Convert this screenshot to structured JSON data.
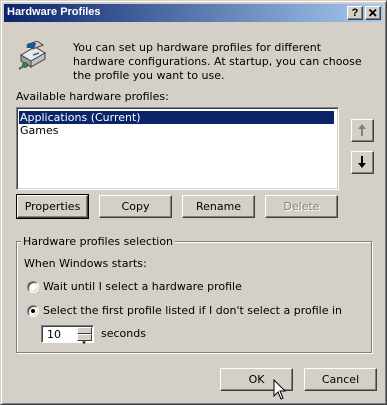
{
  "window": {
    "title": "Hardware Profiles",
    "help_label": "?",
    "close_label": "✕"
  },
  "intro": {
    "icon": "hardware-profiles-icon",
    "text": "You can set up hardware profiles for different hardware configurations.  At startup, you can choose the profile you want to use."
  },
  "profiles": {
    "label": "Available hardware profiles:",
    "items": [
      {
        "label": "Applications (Current)",
        "selected": true
      },
      {
        "label": "Games",
        "selected": false
      }
    ],
    "move_up_icon": "arrow-up-icon",
    "move_down_icon": "arrow-down-icon"
  },
  "actions": {
    "properties": "Properties",
    "copy": "Copy",
    "rename": "Rename",
    "delete": "Delete"
  },
  "selection": {
    "group_title": "Hardware profiles selection",
    "when_label": "When Windows starts:",
    "option_wait": "Wait until I select a hardware profile",
    "option_first": "Select the first profile listed if I don't select a profile in",
    "selected_option": "first",
    "seconds_value": "10",
    "seconds_label": "seconds"
  },
  "footer": {
    "ok": "OK",
    "cancel": "Cancel"
  },
  "colors": {
    "face": "#d4d0c8",
    "title_start": "#0a246a",
    "title_end": "#a6caf0",
    "selection": "#0a246a"
  }
}
